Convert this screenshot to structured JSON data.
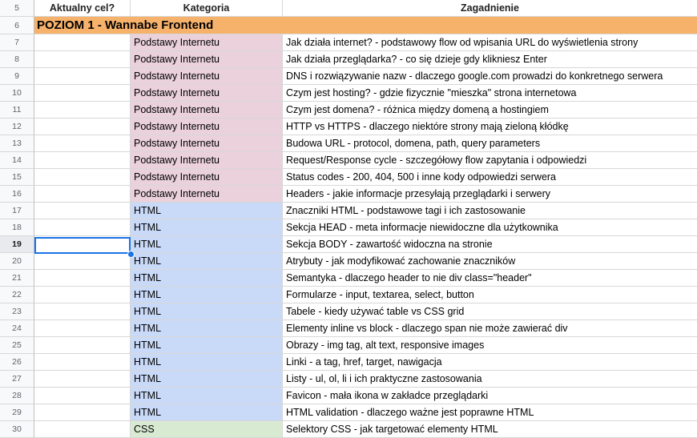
{
  "header": {
    "row_number": "5",
    "col_aim": "Aktualny cel?",
    "col_category": "Kategoria",
    "col_topic": "Zagadnienie"
  },
  "section": {
    "row_number": "6",
    "title": "POZIOM 1 - Wannabe Frontend",
    "color": "#f6b26b"
  },
  "colors": {
    "Podstawy Internetu": "#ead1dc",
    "HTML": "#c9daf8",
    "CSS": "#d9ead3"
  },
  "selected_row": "19",
  "rows": [
    {
      "num": "7",
      "category": "Podstawy Internetu",
      "topic": "Jak działa internet? - podstawowy flow od wpisania URL do wyświetlenia strony"
    },
    {
      "num": "8",
      "category": "Podstawy Internetu",
      "topic": "Jak działa przeglądarka? - co się dzieje gdy klikniesz Enter"
    },
    {
      "num": "9",
      "category": "Podstawy Internetu",
      "topic": "DNS i rozwiązywanie nazw - dlaczego google.com prowadzi do konkretnego serwera"
    },
    {
      "num": "10",
      "category": "Podstawy Internetu",
      "topic": "Czym jest hosting? - gdzie fizycznie \"mieszka\" strona internetowa"
    },
    {
      "num": "11",
      "category": "Podstawy Internetu",
      "topic": "Czym jest domena? - różnica między domeną a hostingiem"
    },
    {
      "num": "12",
      "category": "Podstawy Internetu",
      "topic": "HTTP vs HTTPS - dlaczego niektóre strony mają zieloną kłódkę"
    },
    {
      "num": "13",
      "category": "Podstawy Internetu",
      "topic": "Budowa URL - protocol, domena, path, query parameters"
    },
    {
      "num": "14",
      "category": "Podstawy Internetu",
      "topic": "Request/Response cycle - szczegółowy flow zapytania i odpowiedzi"
    },
    {
      "num": "15",
      "category": "Podstawy Internetu",
      "topic": "Status codes - 200, 404, 500 i inne kody odpowiedzi serwera"
    },
    {
      "num": "16",
      "category": "Podstawy Internetu",
      "topic": "Headers - jakie informacje przesyłają przeglądarki i serwery"
    },
    {
      "num": "17",
      "category": "HTML",
      "topic": "Znaczniki HTML - podstawowe tagi i ich zastosowanie"
    },
    {
      "num": "18",
      "category": "HTML",
      "topic": "Sekcja HEAD - meta informacje niewidoczne dla użytkownika"
    },
    {
      "num": "19",
      "category": "HTML",
      "topic": "Sekcja BODY - zawartość widoczna na stronie"
    },
    {
      "num": "20",
      "category": "HTML",
      "topic": "Atrybuty - jak modyfikować zachowanie znaczników"
    },
    {
      "num": "21",
      "category": "HTML",
      "topic": "Semantyka - dlaczego header to nie div class=\"header\""
    },
    {
      "num": "22",
      "category": "HTML",
      "topic": "Formularze - input, textarea, select, button"
    },
    {
      "num": "23",
      "category": "HTML",
      "topic": "Tabele - kiedy używać table vs CSS grid"
    },
    {
      "num": "24",
      "category": "HTML",
      "topic": "Elementy inline vs block - dlaczego span nie może zawierać div"
    },
    {
      "num": "25",
      "category": "HTML",
      "topic": "Obrazy - img tag, alt text, responsive images"
    },
    {
      "num": "26",
      "category": "HTML",
      "topic": "Linki - a tag, href, target, nawigacja"
    },
    {
      "num": "27",
      "category": "HTML",
      "topic": "Listy - ul, ol, li i ich praktyczne zastosowania"
    },
    {
      "num": "28",
      "category": "HTML",
      "topic": "Favicon - mała ikona w zakładce przeglądarki"
    },
    {
      "num": "29",
      "category": "HTML",
      "topic": "HTML validation - dlaczego ważne jest poprawne HTML"
    },
    {
      "num": "30",
      "category": "CSS",
      "topic": "Selektory CSS - jak targetować elementy HTML"
    }
  ]
}
